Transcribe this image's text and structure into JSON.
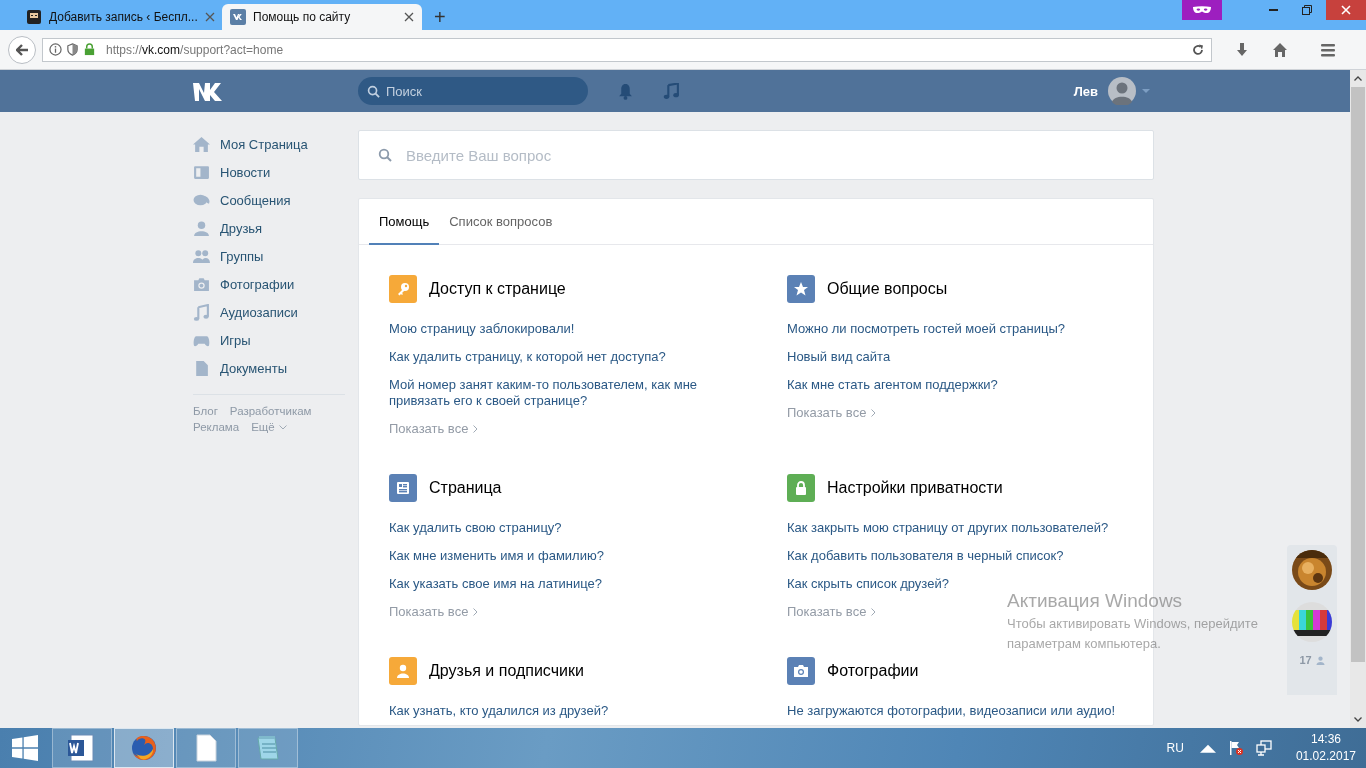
{
  "browser": {
    "tabs": [
      {
        "title": "Добавить запись ‹ Беспл...",
        "selected": false
      },
      {
        "title": "Помощь по сайту",
        "selected": true
      }
    ],
    "new_tab": "+",
    "url_host": "vk.com",
    "url_prefix": "https://",
    "url_path": "/support?act=home"
  },
  "header": {
    "search_placeholder": "Поиск",
    "user_name": "Лев"
  },
  "sidebar": {
    "items": [
      {
        "label": "Моя Страница"
      },
      {
        "label": "Новости"
      },
      {
        "label": "Сообщения"
      },
      {
        "label": "Друзья"
      },
      {
        "label": "Группы"
      },
      {
        "label": "Фотографии"
      },
      {
        "label": "Аудиозаписи"
      },
      {
        "label": "Игры"
      },
      {
        "label": "Документы"
      }
    ],
    "footer_links": [
      "Блог",
      "Разработчикам",
      "Реклама",
      "Ещё"
    ]
  },
  "help": {
    "search_placeholder": "Введите Ваш вопрос",
    "tabs": [
      {
        "label": "Помощь",
        "selected": true
      },
      {
        "label": "Список вопросов",
        "selected": false
      }
    ],
    "sections": [
      {
        "title": "Доступ к странице",
        "color": "#f6a939",
        "questions": [
          "Мою страницу заблокировали!",
          "Как удалить страницу, к которой нет доступа?",
          "Мой номер занят каким-то пользователем, как мне привязать его к своей странице?"
        ],
        "show_all": "Показать все"
      },
      {
        "title": "Общие вопросы",
        "color": "#5b81b5",
        "questions": [
          "Можно ли посмотреть гостей моей страницы?",
          "Новый вид сайта",
          "Как мне стать агентом поддержки?"
        ],
        "show_all": "Показать все"
      },
      {
        "title": "Страница",
        "color": "#5b81b5",
        "questions": [
          "Как удалить свою страницу?",
          "Как мне изменить имя и фамилию?",
          "Как указать свое имя на латинице?"
        ],
        "show_all": "Показать все"
      },
      {
        "title": "Настройки приватности",
        "color": "#5eae55",
        "questions": [
          "Как закрыть мою страницу от других пользователей?",
          "Как добавить пользователя в черный список?",
          "Как скрыть список друзей?"
        ],
        "show_all": "Показать все"
      },
      {
        "title": "Друзья и подписчики",
        "color": "#f6a939",
        "questions": [
          "Как узнать, кто удалился из друзей?"
        ]
      },
      {
        "title": "Фотографии",
        "color": "#5b81b5",
        "questions": [
          "Не загружаются фотографии, видеозаписи или аудио!"
        ]
      }
    ]
  },
  "chat_sidebar": {
    "online_count": "17"
  },
  "windows_watermark": {
    "title": "Активация Windows",
    "lines": [
      "Чтобы активировать Windows, перейдите",
      "параметрам компьютера."
    ]
  },
  "taskbar": {
    "apps": [
      {
        "selected": false
      },
      {
        "selected": true
      },
      {
        "selected": false
      },
      {
        "selected": false
      }
    ],
    "language": "RU",
    "time": "14:36",
    "date": "01.02.2017"
  }
}
